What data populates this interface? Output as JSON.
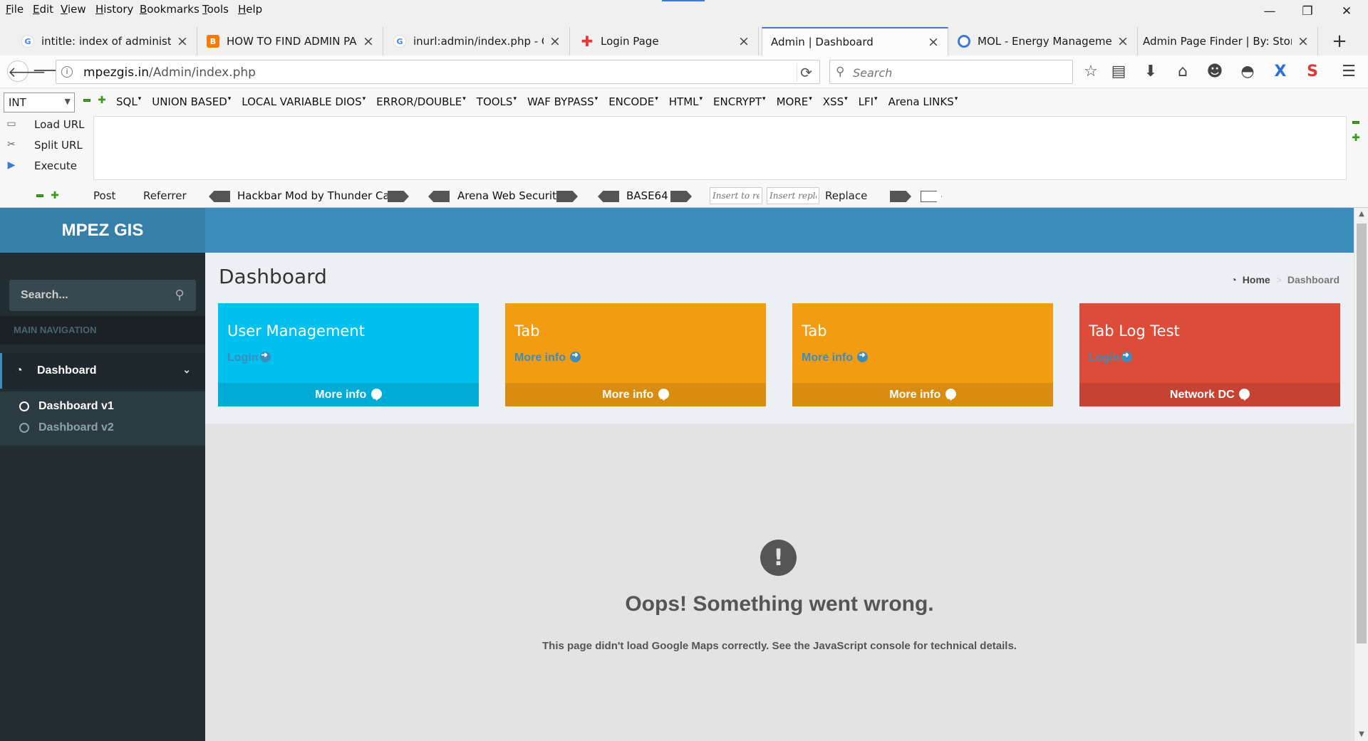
{
  "menubar": {
    "items": [
      "File",
      "Edit",
      "View",
      "History",
      "Bookmarks",
      "Tools",
      "Help"
    ]
  },
  "tabs": [
    {
      "title": "intitle: index of administra...",
      "favicon": "google-icon"
    },
    {
      "title": "HOW TO FIND ADMIN PA...",
      "favicon": "blogger-icon"
    },
    {
      "title": "inurl:admin/index.php - G...",
      "favicon": "google-icon"
    },
    {
      "title": "Login Page",
      "favicon": "plus-icon"
    },
    {
      "title": "Admin | Dashboard",
      "favicon": "none"
    },
    {
      "title": "MOL - Energy Manageme...",
      "favicon": "ring-icon"
    },
    {
      "title": "Admin Page Finder | By: Stone...",
      "favicon": "none"
    }
  ],
  "navbar": {
    "url_host": "mpezgis.in",
    "url_path": "/Admin/index.php",
    "search_placeholder": "Search"
  },
  "hackbar": {
    "select_value": "INT",
    "menus": [
      "SQL",
      "UNION BASED",
      "LOCAL VARIABLE DIOS",
      "ERROR/DOUBLE",
      "TOOLS",
      "WAF BYPASS",
      "ENCODE",
      "HTML",
      "ENCRYPT",
      "MORE",
      "XSS",
      "LFI",
      "Arena LINKS"
    ],
    "actions": {
      "load": "Load URL",
      "split": "Split URL",
      "execute": "Execute"
    },
    "post_label": "Post",
    "referrer_label": "Referrer",
    "mod_label": "Hackbar Mod by Thunder Cats",
    "arena_label": "Arena Web Security",
    "base64_label": "BASE64",
    "insert_rep_placeholder": "Insert to rep",
    "insert_replace_placeholder": "Insert replac",
    "replace_label": "Replace"
  },
  "app": {
    "logo": "MPEZ GIS",
    "sidebar": {
      "search_placeholder": "Search...",
      "header": "MAIN NAVIGATION",
      "active_item": "Dashboard",
      "subitems": [
        "Dashboard v1",
        "Dashboard v2"
      ]
    },
    "content": {
      "title": "Dashboard",
      "breadcrumb_home": "Home",
      "breadcrumb_current": "Dashboard"
    },
    "boxes": [
      {
        "title": "User Management",
        "link": "Login",
        "footer": "More info",
        "color": "#00c0ef",
        "footer_color": "#00acd6"
      },
      {
        "title": "Tab",
        "link": "More info",
        "footer": "More info",
        "color": "#f39c12",
        "footer_color": "#da8c10"
      },
      {
        "title": "Tab",
        "link": "More info",
        "footer": "More info",
        "color": "#f39c12",
        "footer_color": "#da8c10"
      },
      {
        "title": "Tab Log Test",
        "link": "Login",
        "footer": "Network DC",
        "color": "#dd4b39",
        "footer_color": "#c64333"
      }
    ],
    "map_error": {
      "title": "Oops! Something went wrong.",
      "message": "This page didn't load Google Maps correctly. See the JavaScript console for technical details."
    }
  }
}
